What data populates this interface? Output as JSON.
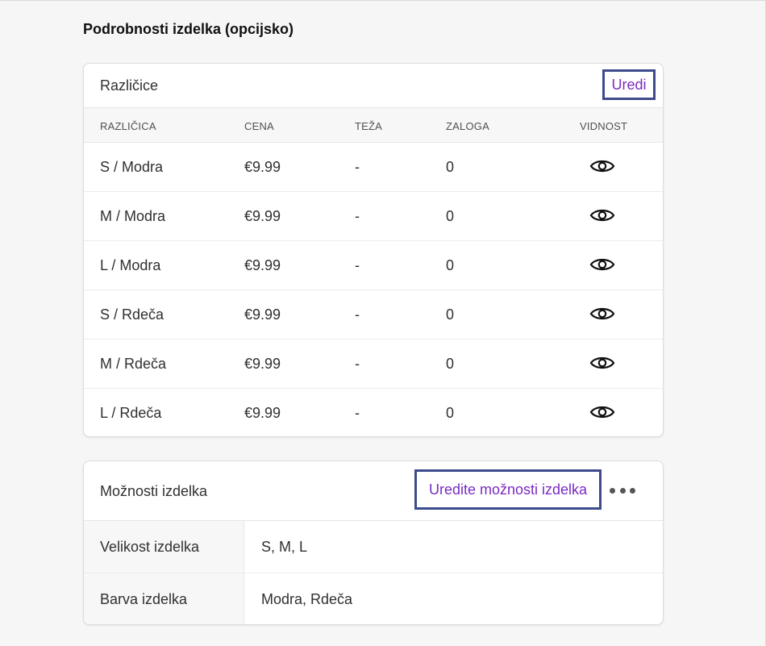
{
  "section_title": "Podrobnosti izdelka (opcijsko)",
  "variants_card": {
    "title": "Različice",
    "edit_label": "Uredi",
    "columns": [
      "RAZLIČICA",
      "CENA",
      "TEŽA",
      "ZALOGA",
      "VIDNOST"
    ],
    "rows": [
      {
        "variant": "S / Modra",
        "price": "€9.99",
        "weight": "-",
        "stock": "0",
        "visibility_icon": "eye-icon"
      },
      {
        "variant": "M / Modra",
        "price": "€9.99",
        "weight": "-",
        "stock": "0",
        "visibility_icon": "eye-icon"
      },
      {
        "variant": "L / Modra",
        "price": "€9.99",
        "weight": "-",
        "stock": "0",
        "visibility_icon": "eye-icon"
      },
      {
        "variant": "S / Rdeča",
        "price": "€9.99",
        "weight": "-",
        "stock": "0",
        "visibility_icon": "eye-icon"
      },
      {
        "variant": "M / Rdeča",
        "price": "€9.99",
        "weight": "-",
        "stock": "0",
        "visibility_icon": "eye-icon"
      },
      {
        "variant": "L / Rdeča",
        "price": "€9.99",
        "weight": "-",
        "stock": "0",
        "visibility_icon": "eye-icon"
      }
    ]
  },
  "options_card": {
    "title": "Možnosti izdelka",
    "edit_label": "Uredite možnosti izdelka",
    "more_icon": "more-horizontal-icon",
    "rows": [
      {
        "label": "Velikost izdelka",
        "value": "S, M, L"
      },
      {
        "label": "Barva izdelka",
        "value": "Modra, Rdeča"
      }
    ]
  },
  "colors": {
    "link": "#7a2bc1",
    "highlight_border": "#3d4b8c",
    "background": "#f6f6f7"
  }
}
